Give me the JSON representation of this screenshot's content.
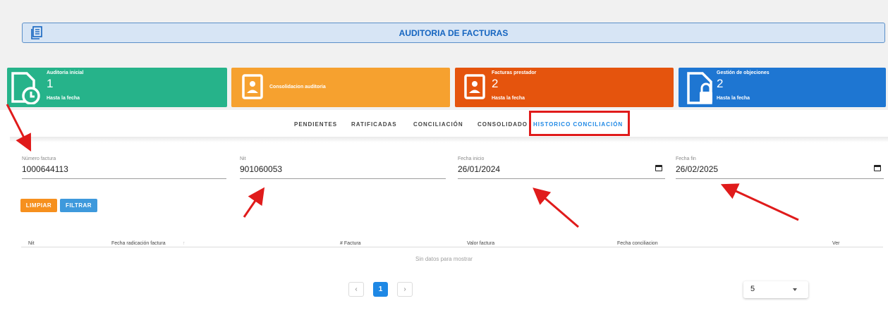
{
  "header": {
    "title": "AUDITORIA DE FACTURAS",
    "icon": "document-list-icon"
  },
  "cards": [
    {
      "title": "Auditoria inicial",
      "count": "1",
      "subtitle": "Hasta la fecha",
      "color": "#26b38a",
      "icon": "document-clock-icon"
    },
    {
      "title": "Consolidacion auditoria",
      "color": "#f6a12f",
      "icon": "id-card-icon"
    },
    {
      "title": "Facturas prestador",
      "count": "2",
      "subtitle": "Hasta la fecha",
      "color": "#e5540d",
      "icon": "id-card-icon"
    },
    {
      "title": "Gestión de objeciones",
      "count": "2",
      "subtitle": "Hasta la fecha",
      "color": "#1e76d2",
      "icon": "document-lock-icon"
    }
  ],
  "tabs": [
    {
      "label": "PENDIENTES"
    },
    {
      "label": "RATIFICADAS"
    },
    {
      "label": "CONCILIACIÓN"
    },
    {
      "label": "CONSOLIDADO"
    },
    {
      "label": "HISTORICO CONCILIACIÓN",
      "active": true
    }
  ],
  "filters": {
    "numero_factura": {
      "label": "Número factura",
      "value": "1000644113"
    },
    "nit": {
      "label": "Nit",
      "value": "901060053"
    },
    "fecha_inicio": {
      "label": "Fecha inicio",
      "value": "26/01/2024"
    },
    "fecha_fin": {
      "label": "Fecha fin",
      "value": "26/02/2025"
    }
  },
  "buttons": {
    "limpiar": "LIMPIAR",
    "filtrar": "FILTRAR"
  },
  "table": {
    "columns": [
      "Nit",
      "Fecha radicación factura",
      "# Factura",
      "Valor factura",
      "Fecha conciliacion",
      "Ver"
    ],
    "sort_indicator": "↑",
    "empty_message": "Sin datos para mostrar"
  },
  "pagination": {
    "prev": "‹",
    "current": "1",
    "next": "›",
    "page_size": "5"
  },
  "annotation_color": "#e01b1b"
}
